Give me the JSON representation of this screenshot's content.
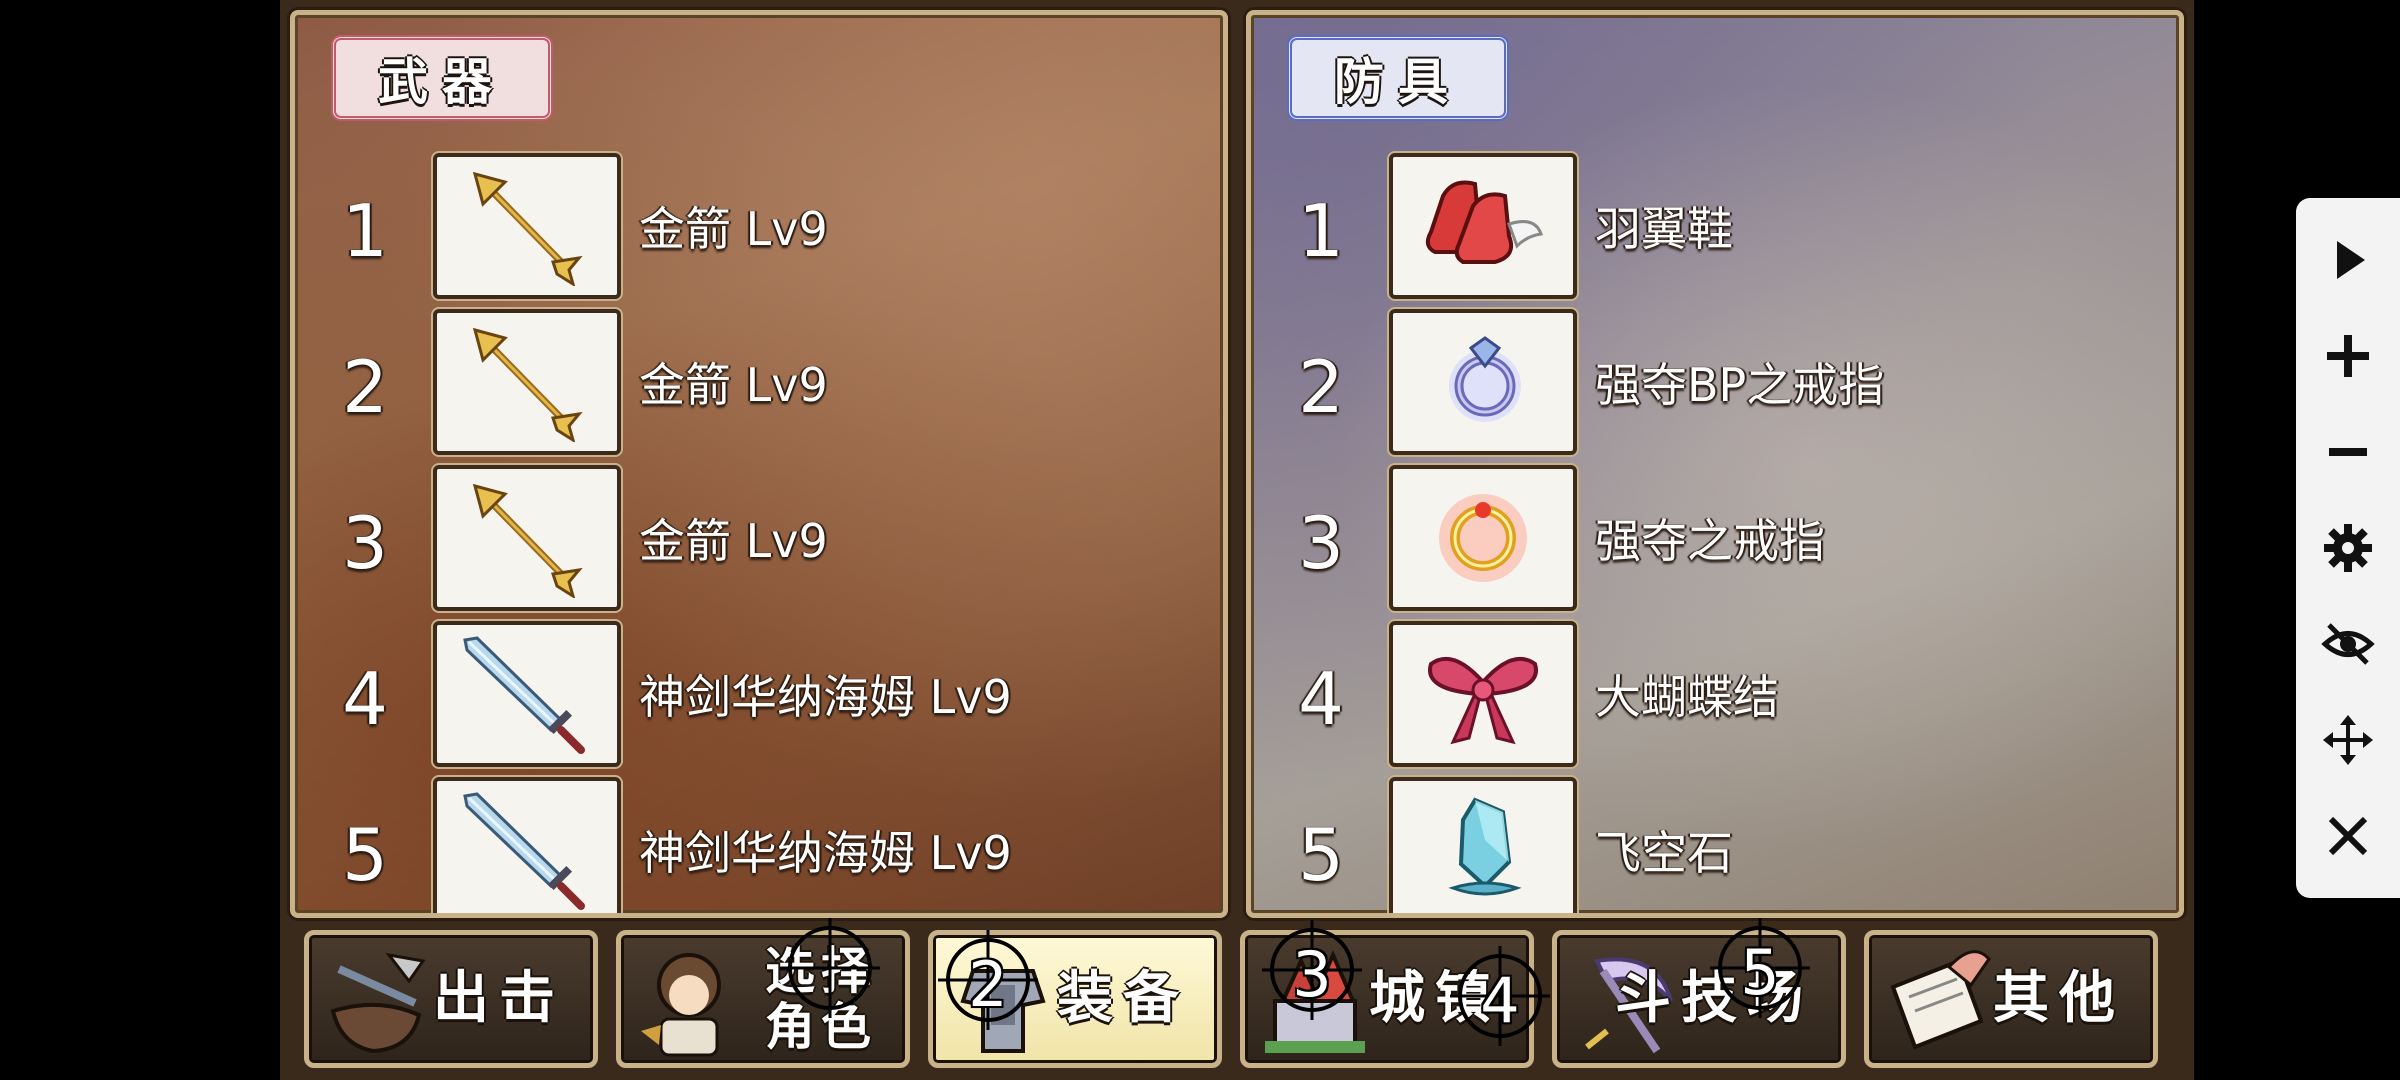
{
  "weapons": {
    "tab_label": "武器",
    "items": [
      {
        "num": "1",
        "name": "金箭 Lv9",
        "icon": "golden-arrow-icon"
      },
      {
        "num": "2",
        "name": "金箭 Lv9",
        "icon": "golden-arrow-icon"
      },
      {
        "num": "3",
        "name": "金箭 Lv9",
        "icon": "golden-arrow-icon"
      },
      {
        "num": "4",
        "name": "神剑华纳海姆 Lv9",
        "icon": "sword-icon"
      },
      {
        "num": "5",
        "name": "神剑华纳海姆 Lv9",
        "icon": "sword-icon"
      }
    ]
  },
  "armor": {
    "tab_label": "防具",
    "items": [
      {
        "num": "1",
        "name": "羽翼鞋",
        "icon": "winged-boots-icon"
      },
      {
        "num": "2",
        "name": "强夺BP之戒指",
        "icon": "bp-ring-icon"
      },
      {
        "num": "3",
        "name": "强夺之戒指",
        "icon": "fire-ring-icon"
      },
      {
        "num": "4",
        "name": "大蝴蝶结",
        "icon": "ribbon-bow-icon"
      },
      {
        "num": "5",
        "name": "飞空石",
        "icon": "crystal-stone-icon"
      }
    ]
  },
  "menu": {
    "sortie": "出击",
    "select_line1": "选择",
    "select_line2": "角色",
    "equip": "装备",
    "town": "城镇",
    "arena": "斗技场",
    "other": "其他",
    "active": "equip"
  },
  "markers": [
    "2",
    "3",
    "4",
    "5"
  ],
  "toolbar": {
    "icons": [
      "play-icon",
      "zoom-in-icon",
      "zoom-out-icon",
      "gear-icon",
      "eye-off-icon",
      "move-icon",
      "close-icon"
    ]
  },
  "colors": {
    "weapon_tab_border": "#c05c6a",
    "armor_tab_border": "#5a6cc0",
    "frame_gold": "#c9b289",
    "active_menu": "#f0e4a8"
  }
}
